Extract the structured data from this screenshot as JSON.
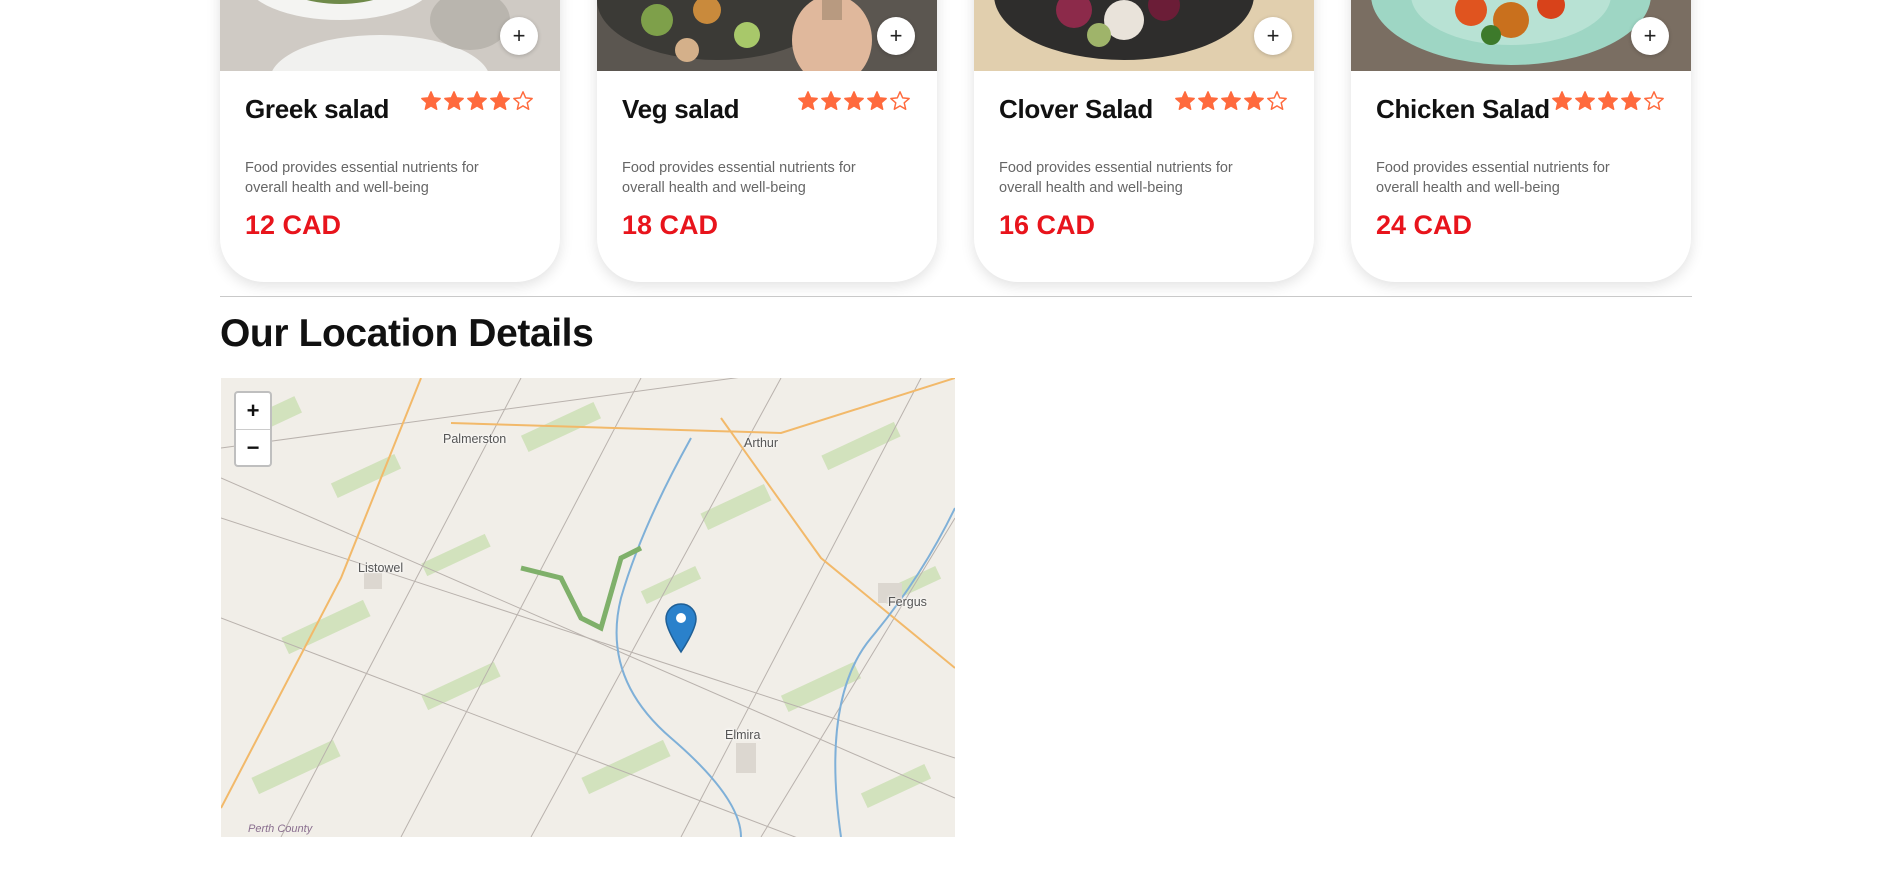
{
  "menu": {
    "items": [
      {
        "name": "Greek salad",
        "description": "Food provides essential nutrients for overall health and well-being",
        "price": "12 CAD",
        "rating": 4,
        "add_label": "+"
      },
      {
        "name": "Veg salad",
        "description": "Food provides essential nutrients for overall health and well-being",
        "price": "18 CAD",
        "rating": 4,
        "add_label": "+"
      },
      {
        "name": "Clover Salad",
        "description": "Food provides essential nutrients for overall health and well-being",
        "price": "16 CAD",
        "rating": 4,
        "add_label": "+"
      },
      {
        "name": "Chicken Salad",
        "description": "Food provides essential nutrients for overall health and well-being",
        "price": "24 CAD",
        "rating": 4,
        "add_label": "+"
      }
    ],
    "star_color": "#ff6a3d",
    "price_color": "#e8141c"
  },
  "location": {
    "title": "Our Location Details",
    "map": {
      "zoom_in_label": "+",
      "zoom_out_label": "−",
      "places": [
        "Palmerston",
        "Arthur",
        "Listowel",
        "Fergus",
        "Elmira"
      ],
      "attribution": "Perth County",
      "marker_icon": "map-marker-icon",
      "marker_color": "#2a81cb"
    }
  }
}
